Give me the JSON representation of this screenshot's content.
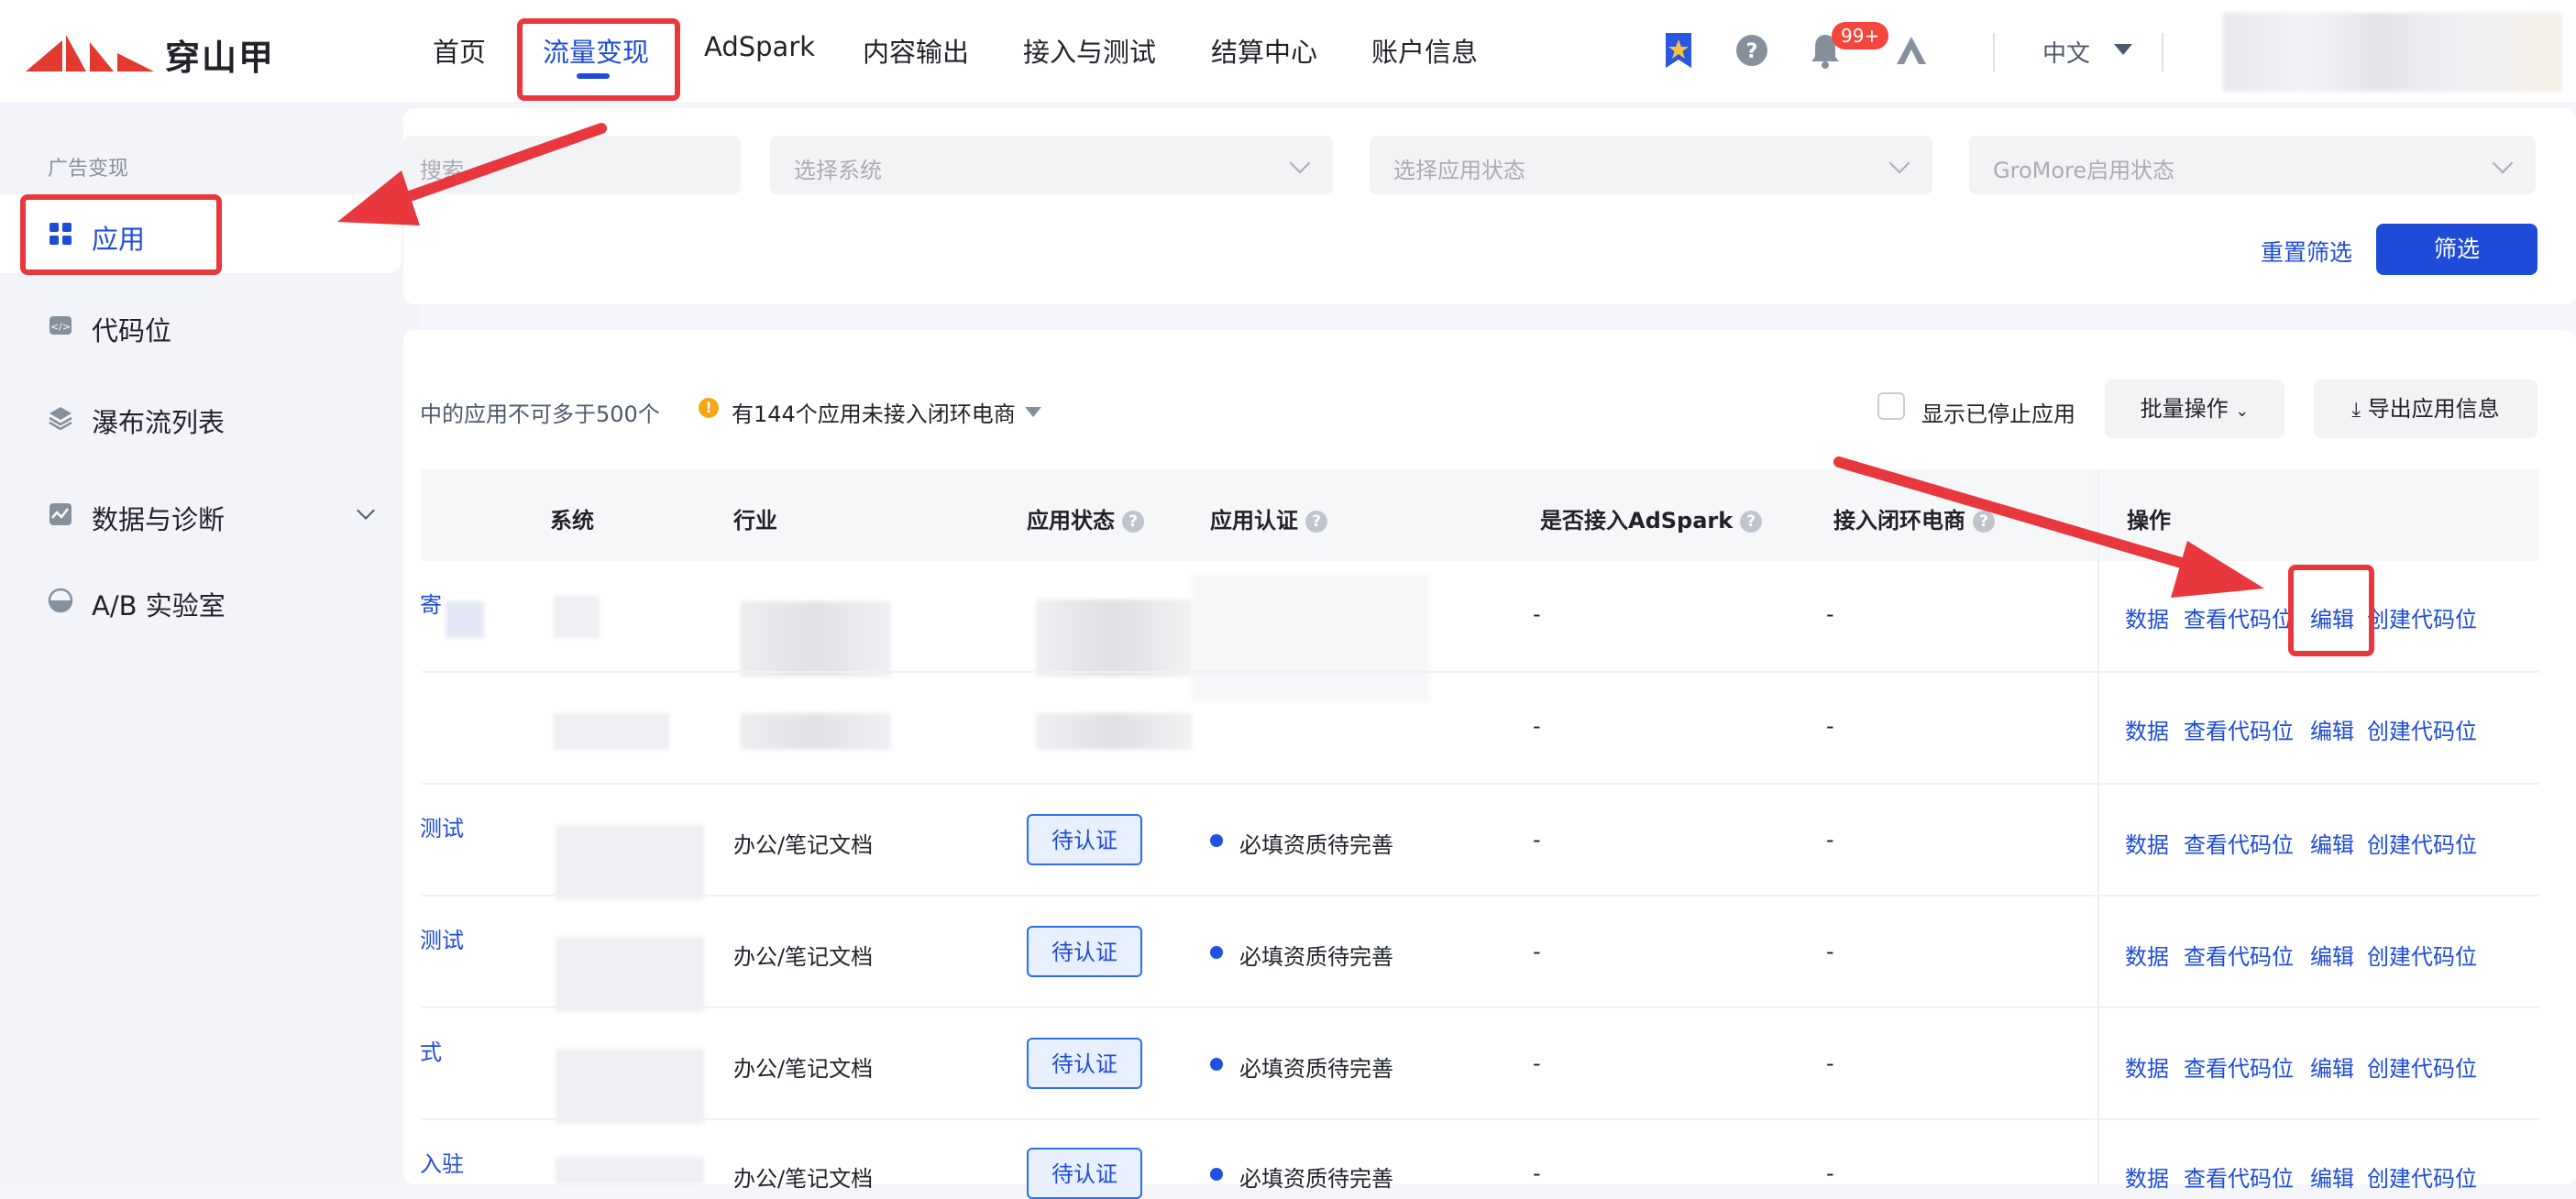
{
  "brand": {
    "name": "穿山甲"
  },
  "nav": {
    "items": [
      {
        "label": "首页"
      },
      {
        "label": "流量变现"
      },
      {
        "label": "AdSpark"
      },
      {
        "label": "内容输出"
      },
      {
        "label": "接入与测试"
      },
      {
        "label": "结算中心"
      },
      {
        "label": "账户信息"
      }
    ],
    "active_index": 1
  },
  "header": {
    "notification_count": "99+",
    "language": "中文"
  },
  "sidebar": {
    "group_label": "广告变现",
    "items": [
      {
        "label": "应用",
        "icon": "grid-icon",
        "active": true
      },
      {
        "label": "代码位",
        "icon": "code-icon"
      },
      {
        "label": "瀑布流列表",
        "icon": "layers-icon"
      },
      {
        "label": "数据与诊断",
        "icon": "chart-icon",
        "expandable": true
      },
      {
        "label": "A/B 实验室",
        "icon": "half-circle-icon"
      }
    ]
  },
  "filters": {
    "search_placeholder": "搜索",
    "system_placeholder": "选择系统",
    "status_placeholder": "选择应用状态",
    "gromore_placeholder": "GroMore启用状态",
    "reset_label": "重置筛选",
    "submit_label": "筛选"
  },
  "toolbar": {
    "limit_note": "中的应用不可多于500个",
    "warning": "有144个应用未接入闭环电商",
    "show_stopped_label": "显示已停止应用",
    "batch_label": "批量操作",
    "export_label": "导出应用信息"
  },
  "table": {
    "columns": [
      "系统",
      "行业",
      "应用状态",
      "应用认证",
      "是否接入AdSpark",
      "接入闭环电商",
      "操作"
    ],
    "rows": [
      {
        "name": "寄",
        "industry": "",
        "status": "",
        "cert": "",
        "adspark": "-",
        "ecom": "-"
      },
      {
        "name": "",
        "industry": "",
        "status": "",
        "cert": "",
        "adspark": "-",
        "ecom": "-"
      },
      {
        "name": "测试",
        "industry": "办公/笔记文档",
        "status": "待认证",
        "cert": "必填资质待完善",
        "adspark": "-",
        "ecom": "-"
      },
      {
        "name": "测试",
        "industry": "办公/笔记文档",
        "status": "待认证",
        "cert": "必填资质待完善",
        "adspark": "-",
        "ecom": "-"
      },
      {
        "name": "式",
        "industry": "办公/笔记文档",
        "status": "待认证",
        "cert": "必填资质待完善",
        "adspark": "-",
        "ecom": "-"
      },
      {
        "name": "入驻",
        "industry": "办公/笔记文档",
        "status": "待认证",
        "cert": "必填资质待完善",
        "adspark": "-",
        "ecom": "-"
      }
    ],
    "actions": {
      "data": "数据",
      "view_codes": "查看代码位",
      "edit": "编辑",
      "create_code": "创建代码位"
    }
  },
  "colors": {
    "primary": "#1e4bd8",
    "annotation": "#e8383d",
    "warning": "#f7a614"
  }
}
